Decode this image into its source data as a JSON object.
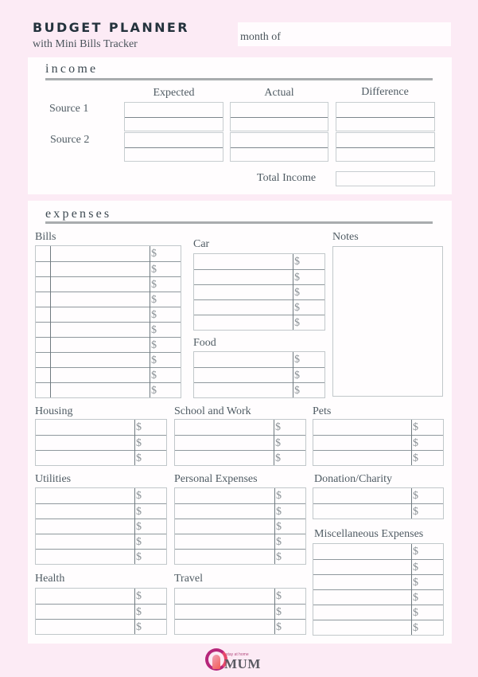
{
  "header": {
    "title": "BUDGET PLANNER",
    "subtitle": "with Mini Bills Tracker",
    "month_label": "month of",
    "month_value": ""
  },
  "income": {
    "heading": "income",
    "columns": [
      "Expected",
      "Actual",
      "Difference"
    ],
    "sources": [
      {
        "label": "Source 1",
        "expected": [
          "",
          ""
        ],
        "actual": [
          "",
          ""
        ],
        "difference": [
          "",
          ""
        ]
      },
      {
        "label": "Source 2",
        "expected": [
          "",
          ""
        ],
        "actual": [
          "",
          ""
        ],
        "difference": [
          "",
          ""
        ]
      }
    ],
    "total_label": "Total Income",
    "total_value": ""
  },
  "expenses": {
    "heading": "expenses",
    "currency_symbol": "$",
    "notes_label": "Notes",
    "notes_value": "",
    "categories": {
      "bills": {
        "label": "Bills",
        "rows": 10,
        "has_checkbox": true
      },
      "car": {
        "label": "Car",
        "rows": 5
      },
      "food": {
        "label": "Food",
        "rows": 3
      },
      "housing": {
        "label": "Housing",
        "rows": 3
      },
      "school_work": {
        "label": "School and Work",
        "rows": 3
      },
      "pets": {
        "label": "Pets",
        "rows": 3
      },
      "utilities": {
        "label": "Utilities",
        "rows": 5
      },
      "personal": {
        "label": "Personal Expenses",
        "rows": 5
      },
      "donation": {
        "label": "Donation/Charity",
        "rows": 2
      },
      "misc": {
        "label": "Miscellaneous Expenses",
        "rows": 6
      },
      "health": {
        "label": "Health",
        "rows": 3
      },
      "travel": {
        "label": "Travel",
        "rows": 3
      }
    }
  },
  "footer": {
    "logo_small_text": "stay at home",
    "logo_text": "MUM"
  }
}
